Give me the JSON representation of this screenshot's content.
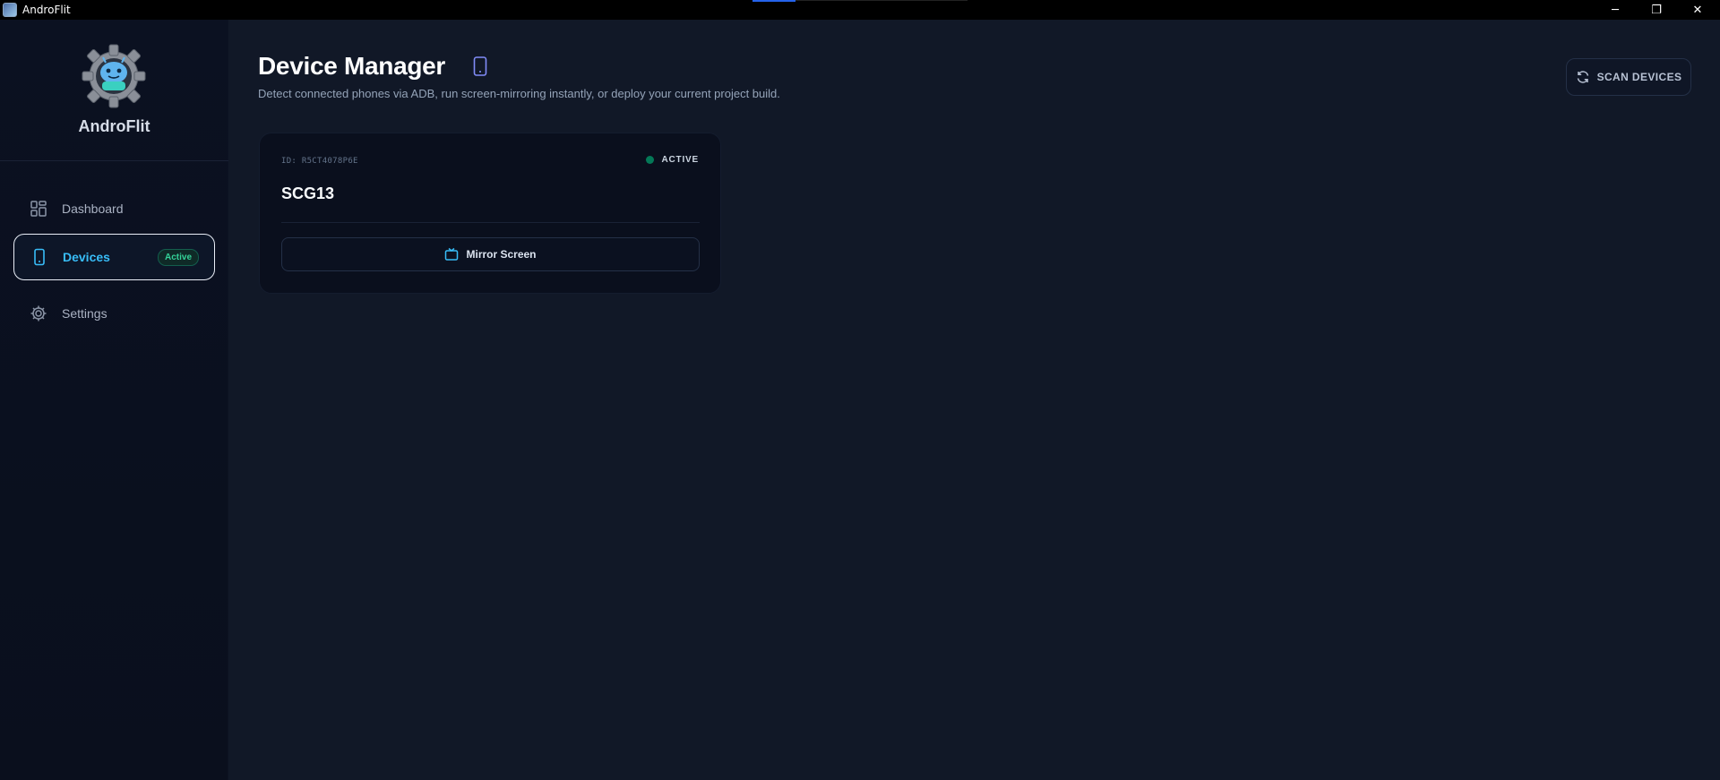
{
  "window": {
    "title": "AndroFlit",
    "controls": {
      "minimize": "─",
      "maximize": "❐",
      "close": "✕"
    }
  },
  "sidebar": {
    "brand": "AndroFlit",
    "logo_icon": "gear-android-robot-logo",
    "items": [
      {
        "label": "Dashboard",
        "icon": "grid-icon",
        "active": false
      },
      {
        "label": "Devices",
        "icon": "phone-icon",
        "active": true,
        "badge": "Active"
      },
      {
        "label": "Settings",
        "icon": "gear-icon",
        "active": false
      }
    ]
  },
  "header": {
    "title": "Device Manager",
    "title_icon": "phone-icon",
    "subtitle": "Detect connected phones via ADB, run screen-mirroring instantly, or deploy your current project build.",
    "scan_button": "SCAN DEVICES",
    "scan_icon": "refresh-icon"
  },
  "devices": [
    {
      "id": "ID: R5CT4078P6E",
      "status": "ACTIVE",
      "name": "SCG13",
      "mirror_button": "Mirror Screen",
      "mirror_icon": "tv-icon"
    }
  ],
  "colors": {
    "accent": "#38bdf8",
    "active_green": "#34d399",
    "status_dot": "#047857",
    "background": "#111827",
    "sidebar": "#0b1121"
  }
}
